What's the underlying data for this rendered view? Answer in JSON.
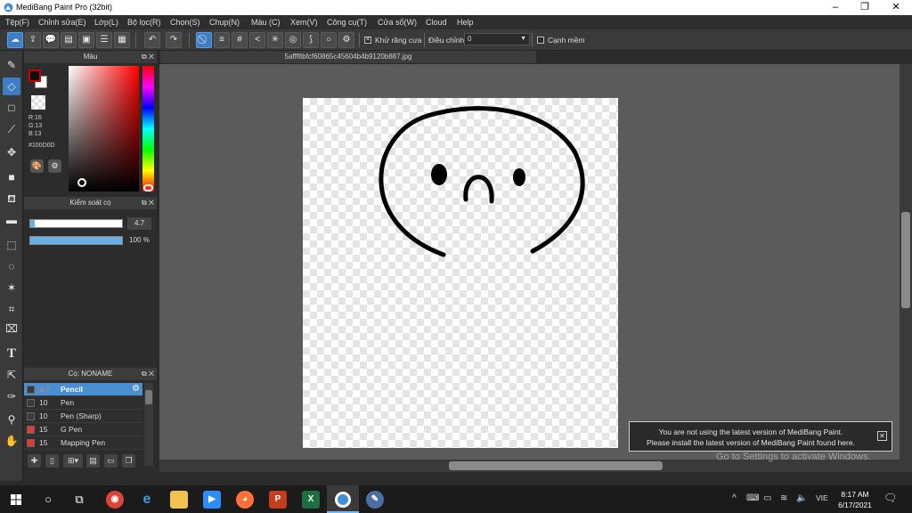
{
  "window": {
    "title": "MediBang Paint Pro (32bit)",
    "min_icon": "minimize-icon",
    "max_icon": "restore-icon",
    "close_icon": "close-icon"
  },
  "menu": [
    "Tệp(F)",
    "Chỉnh sửa(E)",
    "Lớp(L)",
    "Bộ lọc(R)",
    "Chọn(S)",
    "Chụp(N)",
    "Màu (C)",
    "Xem(V)",
    "Công cụ(T)",
    "Cửa sổ(W)",
    "Cloud",
    "Help"
  ],
  "toolbar": {
    "antialias_label": "Khử răng cưa",
    "antialias_checked": true,
    "correction_label": "Điều chỉnh",
    "correction_value": "0",
    "soft_edge_label": "Cạnh mềm",
    "soft_edge_checked": false
  },
  "color_panel": {
    "title": "Màu",
    "r": "R:16",
    "g": "G:13",
    "b": "B:13",
    "hex": "#100D0D",
    "fg_color": "#100d0d",
    "bg_color": "#ffffff"
  },
  "brush_control": {
    "title": "Kiểm soát cọ",
    "size_value": "4.7",
    "size_fraction": 0.05,
    "opacity_value": "100 %",
    "opacity_fraction": 1.0
  },
  "brush_panel": {
    "title": "Cọ: NONAME",
    "brushes": [
      {
        "size": "4.7",
        "name": "Pencil",
        "color": "#3a3a3a",
        "selected": true
      },
      {
        "size": "10",
        "name": "Pen",
        "color": "#3a3a3a",
        "selected": false
      },
      {
        "size": "10",
        "name": "Pen (Sharp)",
        "color": "#3a3a3a",
        "selected": false
      },
      {
        "size": "15",
        "name": "G Pen",
        "color": "#e53935",
        "selected": false
      },
      {
        "size": "15",
        "name": "Mapping Pen",
        "color": "#e53935",
        "selected": false
      }
    ]
  },
  "document": {
    "tab_name": "5afff8bfcf60865c45604b4b9120b887.jpg"
  },
  "notice": {
    "line1": "You are not using the latest version of MediBang Paint.",
    "line2": "Please install the latest version of MediBang Paint found here."
  },
  "watermark": "Go to Settings to activate Windows.",
  "taskbar": {
    "lang": "VIE",
    "time": "8:17 AM",
    "date": "6/17/2021"
  }
}
